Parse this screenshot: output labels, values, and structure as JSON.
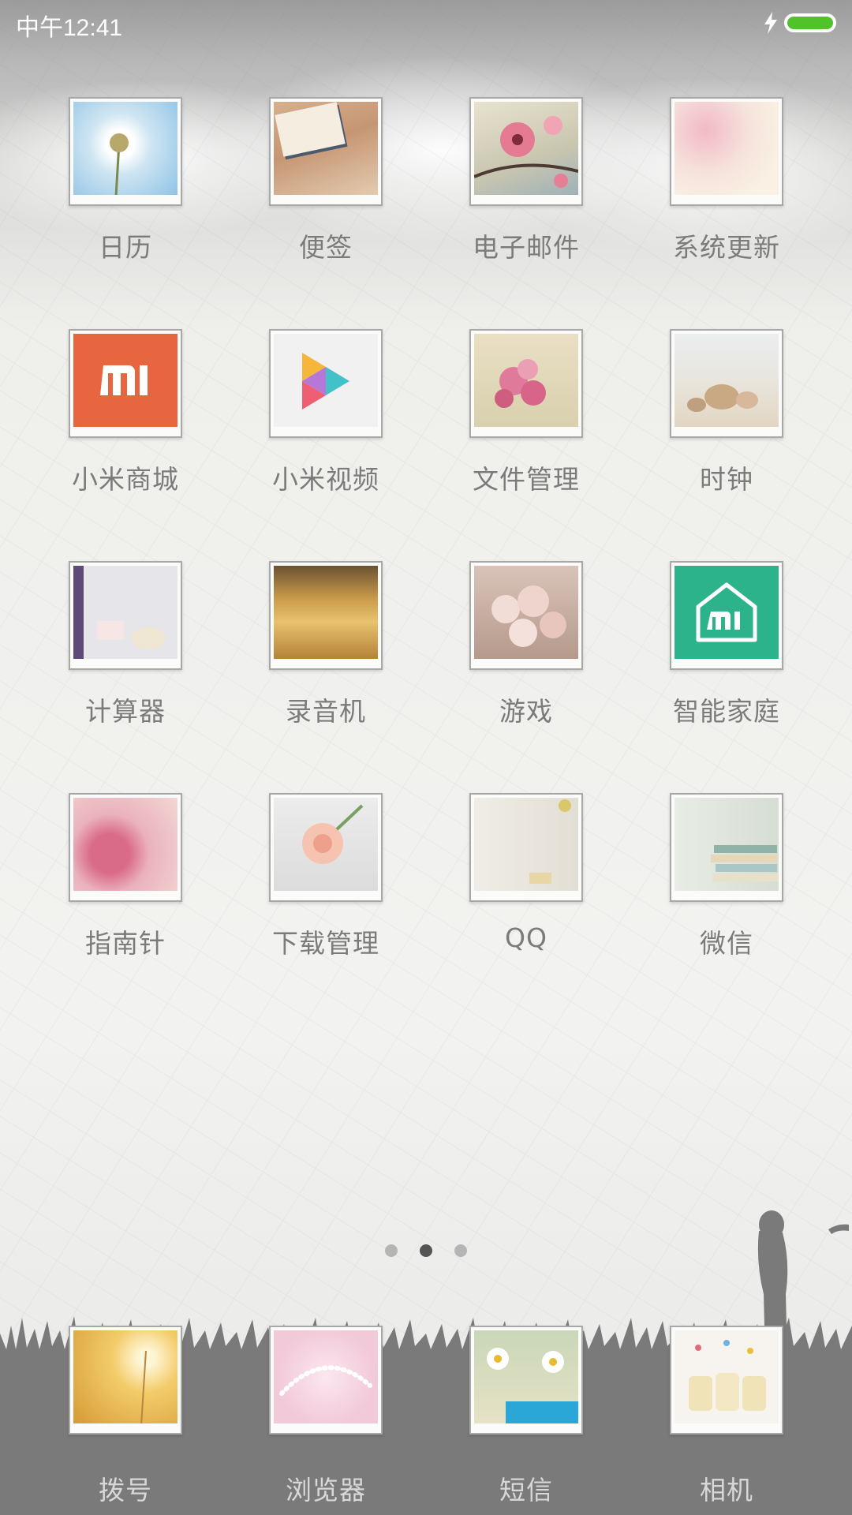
{
  "status_bar": {
    "time": "中午12:41",
    "battery_color": "#51c22a"
  },
  "apps": [
    {
      "label": "日历",
      "icon": "dandelion-photo-icon"
    },
    {
      "label": "便签",
      "icon": "notebook-photo-icon"
    },
    {
      "label": "电子邮件",
      "icon": "cherry-blossom-photo-icon"
    },
    {
      "label": "系统更新",
      "icon": "flower-blur-photo-icon"
    },
    {
      "label": "小米商城",
      "icon": "mi-logo-icon",
      "color": "#e8663f"
    },
    {
      "label": "小米视频",
      "icon": "play-triangle-icon"
    },
    {
      "label": "文件管理",
      "icon": "pink-flowers-photo-icon"
    },
    {
      "label": "时钟",
      "icon": "seashells-photo-icon"
    },
    {
      "label": "计算器",
      "icon": "window-cup-photo-icon"
    },
    {
      "label": "录音机",
      "icon": "golden-grass-photo-icon"
    },
    {
      "label": "游戏",
      "icon": "roses-bouquet-photo-icon"
    },
    {
      "label": "智能家庭",
      "icon": "mi-home-icon",
      "color": "#2db38c"
    },
    {
      "label": "指南针",
      "icon": "pink-rose-photo-icon"
    },
    {
      "label": "下载管理",
      "icon": "peach-rose-photo-icon"
    },
    {
      "label": "QQ",
      "icon": "room-plant-photo-icon"
    },
    {
      "label": "微信",
      "icon": "books-photo-icon"
    }
  ],
  "dock": [
    {
      "label": "拨号",
      "icon": "dandelion-sunset-photo-icon"
    },
    {
      "label": "浏览器",
      "icon": "pearls-photo-icon"
    },
    {
      "label": "短信",
      "icon": "daisy-cup-photo-icon"
    },
    {
      "label": "相机",
      "icon": "yogurt-jars-photo-icon"
    }
  ],
  "page_indicator": {
    "pages": 3,
    "current": 2
  }
}
